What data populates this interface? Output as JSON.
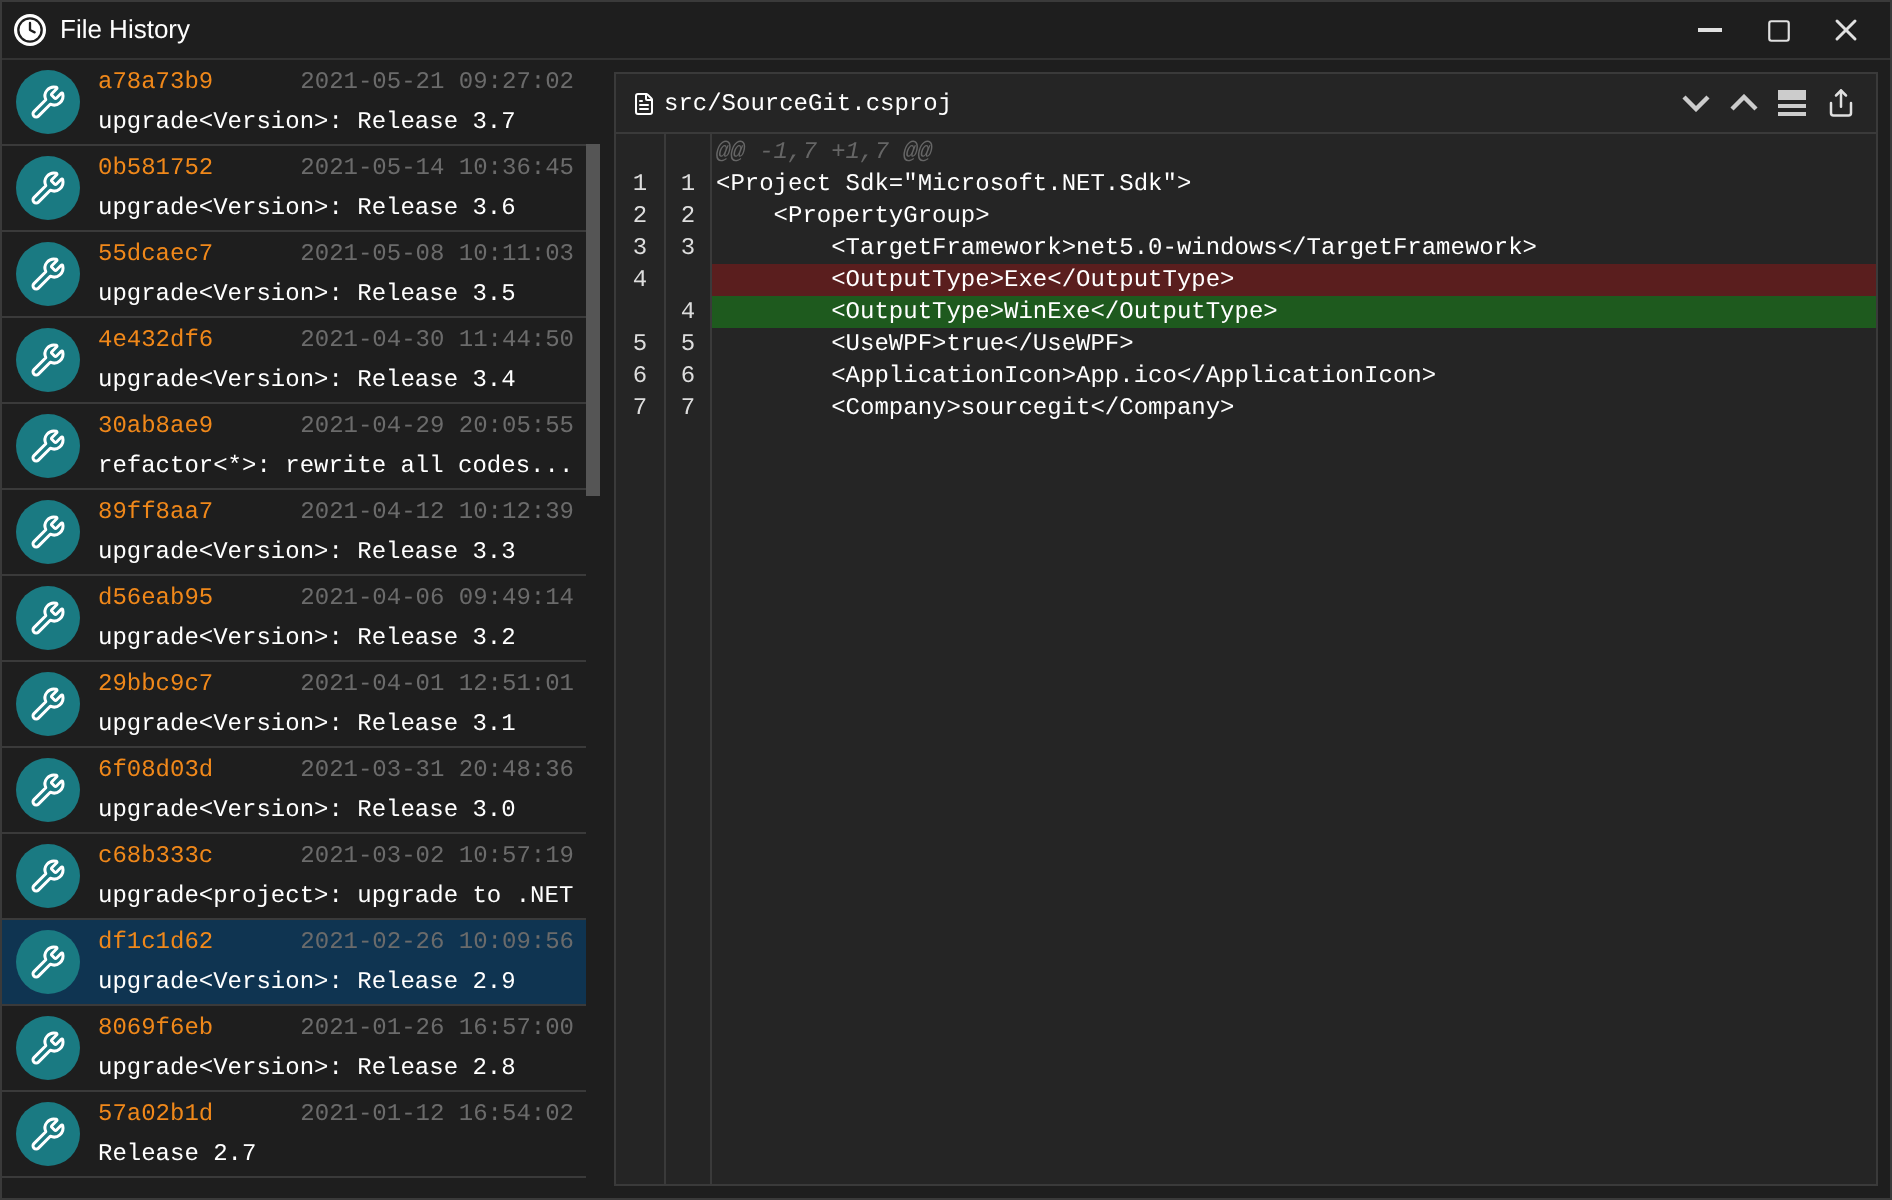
{
  "window": {
    "title": "File History"
  },
  "commits": [
    {
      "hash": "a78a73b9",
      "date": "2021-05-21 09:27:02",
      "message": "upgrade<Version>: Release 3.7",
      "selected": false
    },
    {
      "hash": "0b581752",
      "date": "2021-05-14 10:36:45",
      "message": "upgrade<Version>: Release 3.6",
      "selected": false
    },
    {
      "hash": "55dcaec7",
      "date": "2021-05-08 10:11:03",
      "message": "upgrade<Version>: Release 3.5",
      "selected": false
    },
    {
      "hash": "4e432df6",
      "date": "2021-04-30 11:44:50",
      "message": "upgrade<Version>: Release 3.4",
      "selected": false
    },
    {
      "hash": "30ab8ae9",
      "date": "2021-04-29 20:05:55",
      "message": "refactor<*>: rewrite all codes...",
      "selected": false
    },
    {
      "hash": "89ff8aa7",
      "date": "2021-04-12 10:12:39",
      "message": "upgrade<Version>: Release 3.3",
      "selected": false
    },
    {
      "hash": "d56eab95",
      "date": "2021-04-06 09:49:14",
      "message": "upgrade<Version>: Release 3.2",
      "selected": false
    },
    {
      "hash": "29bbc9c7",
      "date": "2021-04-01 12:51:01",
      "message": "upgrade<Version>: Release 3.1",
      "selected": false
    },
    {
      "hash": "6f08d03d",
      "date": "2021-03-31 20:48:36",
      "message": "upgrade<Version>: Release 3.0",
      "selected": false
    },
    {
      "hash": "c68b333c",
      "date": "2021-03-02 10:57:19",
      "message": "upgrade<project>: upgrade to .NET",
      "selected": false
    },
    {
      "hash": "df1c1d62",
      "date": "2021-02-26 10:09:56",
      "message": "upgrade<Version>: Release 2.9",
      "selected": true
    },
    {
      "hash": "8069f6eb",
      "date": "2021-01-26 16:57:00",
      "message": "upgrade<Version>: Release 2.8",
      "selected": false
    },
    {
      "hash": "57a02b1d",
      "date": "2021-01-12 16:54:02",
      "message": "Release 2.7",
      "selected": false
    }
  ],
  "diff": {
    "file_path": "src/SourceGit.csproj",
    "lines": [
      {
        "kind": "hunk",
        "text": "@@ -1,7 +1,7 @@"
      },
      {
        "kind": "normal",
        "old": "1",
        "new": "1",
        "text": "<Project Sdk=\"Microsoft.NET.Sdk\">"
      },
      {
        "kind": "normal",
        "old": "2",
        "new": "2",
        "text": "    <PropertyGroup>"
      },
      {
        "kind": "normal",
        "old": "3",
        "new": "3",
        "text": "        <TargetFramework>net5.0-windows</TargetFramework>"
      },
      {
        "kind": "deleted",
        "old": "4",
        "text": "        <OutputType>Exe</OutputType>"
      },
      {
        "kind": "added",
        "new": "4",
        "text": "        <OutputType>WinExe</OutputType>"
      },
      {
        "kind": "normal",
        "old": "5",
        "new": "5",
        "text": "        <UseWPF>true</UseWPF>"
      },
      {
        "kind": "normal",
        "old": "6",
        "new": "6",
        "text": "        <ApplicationIcon>App.ico</ApplicationIcon>"
      },
      {
        "kind": "normal",
        "old": "7",
        "new": "7",
        "text": "        <Company>sourcegit</Company>"
      }
    ]
  }
}
